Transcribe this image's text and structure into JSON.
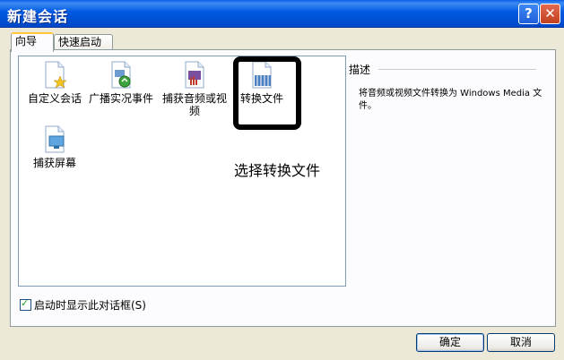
{
  "window": {
    "title": "新建会话",
    "help_glyph": "?",
    "close_glyph": "✕"
  },
  "tabs": [
    {
      "label": "向导",
      "active": true
    },
    {
      "label": "快速启动",
      "active": false
    }
  ],
  "items": [
    {
      "label": "自定义会话",
      "icon": "custom-session-icon"
    },
    {
      "label": "广播实况事件",
      "icon": "broadcast-live-icon"
    },
    {
      "label": "捕获音频或视频",
      "icon": "capture-av-icon"
    },
    {
      "label": "转换文件",
      "icon": "convert-file-icon"
    },
    {
      "label": "捕获屏幕",
      "icon": "capture-screen-icon"
    }
  ],
  "annotation": "选择转换文件",
  "description": {
    "title": "描述",
    "text": "将音频或视频文件转换为 Windows Media 文件。"
  },
  "checkbox": {
    "label": "启动时显示此对话框(S)",
    "checked": true
  },
  "buttons": {
    "ok": "确定",
    "cancel": "取消"
  }
}
